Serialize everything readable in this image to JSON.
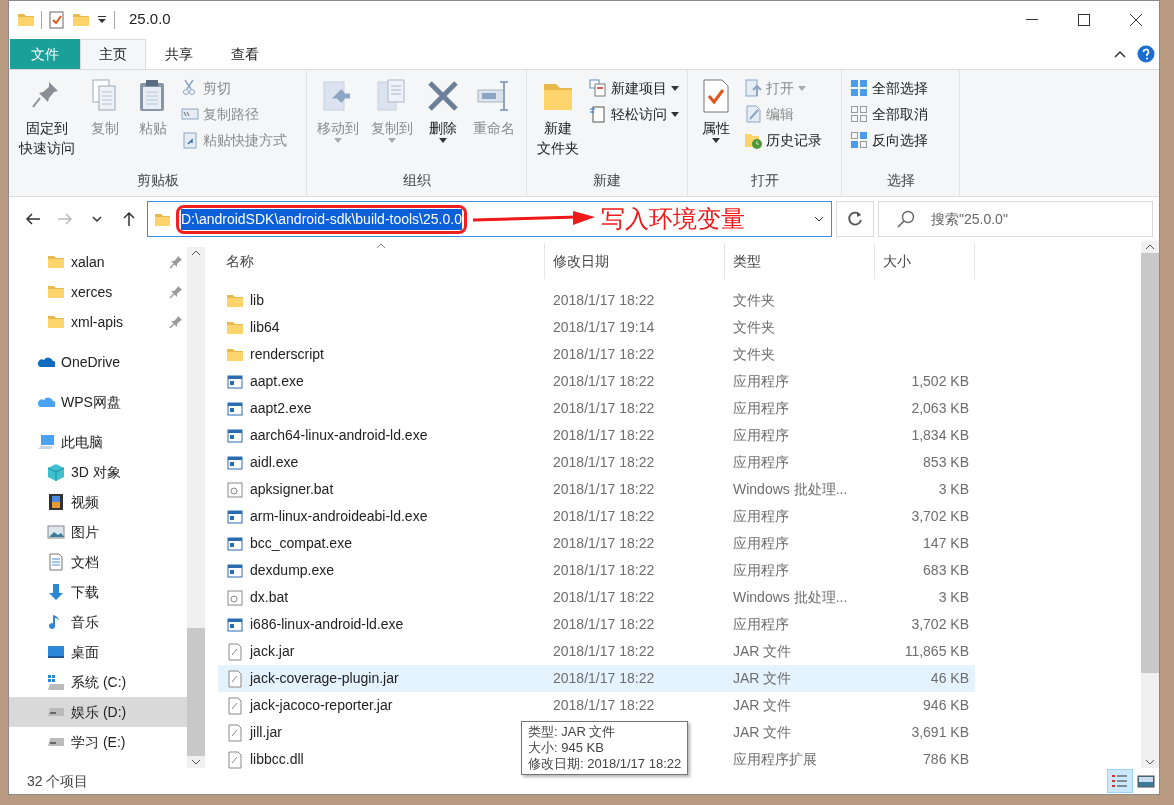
{
  "window": {
    "title": "25.0.0"
  },
  "ribbon_tabs": [
    {
      "label": "文件",
      "kind": "file",
      "selected": false
    },
    {
      "label": "主页",
      "kind": "tab",
      "selected": true
    },
    {
      "label": "共享",
      "kind": "tab",
      "selected": false
    },
    {
      "label": "查看",
      "kind": "tab",
      "selected": false
    }
  ],
  "ribbon_groups": [
    {
      "label": "剪贴板",
      "items": [
        {
          "kind": "large",
          "lines": [
            "固定到",
            "快速访问"
          ],
          "disabled": false
        },
        {
          "kind": "large",
          "lines": [
            "复制"
          ],
          "disabled": true
        },
        {
          "kind": "large",
          "lines": [
            "粘贴"
          ],
          "disabled": true
        },
        {
          "kind": "stack",
          "entries": [
            {
              "label": "剪切",
              "disabled": true
            },
            {
              "label": "复制路径",
              "disabled": true
            },
            {
              "label": "粘贴快捷方式",
              "disabled": true
            }
          ]
        }
      ]
    },
    {
      "label": "组织",
      "items": [
        {
          "kind": "large",
          "lines": [
            "移动到"
          ],
          "disabled": true,
          "dropdown": true
        },
        {
          "kind": "large",
          "lines": [
            "复制到"
          ],
          "disabled": true,
          "dropdown": true
        },
        {
          "kind": "large",
          "lines": [
            "删除"
          ],
          "disabled": false,
          "dropdown": true
        },
        {
          "kind": "large",
          "lines": [
            "重命名"
          ],
          "disabled": true
        }
      ]
    },
    {
      "label": "新建",
      "items": [
        {
          "kind": "large",
          "lines": [
            "新建",
            "文件夹"
          ],
          "disabled": false
        },
        {
          "kind": "stack",
          "entries": [
            {
              "label": "新建项目",
              "disabled": false,
              "dropdown": true
            },
            {
              "label": "轻松访问",
              "disabled": false,
              "dropdown": true
            }
          ]
        }
      ]
    },
    {
      "label": "打开",
      "items": [
        {
          "kind": "large",
          "lines": [
            "属性"
          ],
          "disabled": false,
          "dropdown": true
        },
        {
          "kind": "stack",
          "entries": [
            {
              "label": "打开",
              "disabled": true,
              "dropdown": true
            },
            {
              "label": "编辑",
              "disabled": true
            },
            {
              "label": "历史记录",
              "disabled": false
            }
          ]
        }
      ]
    },
    {
      "label": "选择",
      "items": [
        {
          "kind": "stack",
          "entries": [
            {
              "label": "全部选择",
              "disabled": false
            },
            {
              "label": "全部取消",
              "disabled": false
            },
            {
              "label": "反向选择",
              "disabled": false
            }
          ]
        }
      ]
    }
  ],
  "address": {
    "path": "D:\\androidSDK\\android-sdk\\build-tools\\25.0.0",
    "selected": true,
    "annotation": "写入环境变量"
  },
  "search": {
    "placeholder": "搜索\"25.0.0\""
  },
  "nav": [
    {
      "label": "xalan",
      "kind": "folder",
      "pinned": true,
      "selected": false
    },
    {
      "label": "xerces",
      "kind": "folder",
      "pinned": true,
      "selected": false
    },
    {
      "label": "xml-apis",
      "kind": "folder",
      "pinned": true,
      "selected": false
    },
    {
      "label": "OneDrive",
      "kind": "onedrive",
      "selected": false
    },
    {
      "label": "WPS网盘",
      "kind": "cloud",
      "selected": false
    },
    {
      "label": "此电脑",
      "kind": "pc",
      "selected": false,
      "children": [
        {
          "label": "3D 对象",
          "kind": "cube",
          "selected": false
        },
        {
          "label": "视频",
          "kind": "video",
          "selected": false
        },
        {
          "label": "图片",
          "kind": "image",
          "selected": false
        },
        {
          "label": "文档",
          "kind": "doc",
          "selected": false
        },
        {
          "label": "下载",
          "kind": "download",
          "selected": false
        },
        {
          "label": "音乐",
          "kind": "music",
          "selected": false
        },
        {
          "label": "桌面",
          "kind": "desktop",
          "selected": false
        },
        {
          "label": "系统 (C:)",
          "kind": "sysdrive",
          "selected": false
        },
        {
          "label": "娱乐 (D:)",
          "kind": "drive",
          "selected": true
        },
        {
          "label": "学习 (E:)",
          "kind": "drive",
          "selected": false
        }
      ]
    }
  ],
  "columns": [
    {
      "label": "名称",
      "sorted": true
    },
    {
      "label": "修改日期",
      "sorted": false
    },
    {
      "label": "类型",
      "sorted": false
    },
    {
      "label": "大小",
      "sorted": false
    }
  ],
  "files": [
    {
      "name": "lib",
      "kind": "folder",
      "date": "2018/1/17 18:22",
      "type": "文件夹",
      "hovered": false
    },
    {
      "name": "lib64",
      "kind": "folder",
      "date": "2018/1/17 19:14",
      "type": "文件夹",
      "hovered": false
    },
    {
      "name": "renderscript",
      "kind": "folder",
      "date": "2018/1/17 18:22",
      "type": "文件夹",
      "hovered": false
    },
    {
      "name": "aapt.exe",
      "kind": "exe",
      "date": "2018/1/17 18:22",
      "type": "应用程序",
      "size": "1,502 KB",
      "hovered": false
    },
    {
      "name": "aapt2.exe",
      "kind": "exe",
      "date": "2018/1/17 18:22",
      "type": "应用程序",
      "size": "2,063 KB",
      "hovered": false
    },
    {
      "name": "aarch64-linux-android-ld.exe",
      "kind": "exe",
      "date": "2018/1/17 18:22",
      "type": "应用程序",
      "size": "1,834 KB",
      "hovered": false
    },
    {
      "name": "aidl.exe",
      "kind": "exe",
      "date": "2018/1/17 18:22",
      "type": "应用程序",
      "size": "853 KB",
      "hovered": false
    },
    {
      "name": "apksigner.bat",
      "kind": "bat",
      "date": "2018/1/17 18:22",
      "type": "Windows 批处理...",
      "size": "3 KB",
      "hovered": false
    },
    {
      "name": "arm-linux-androideabi-ld.exe",
      "kind": "exe",
      "date": "2018/1/17 18:22",
      "type": "应用程序",
      "size": "3,702 KB",
      "hovered": false
    },
    {
      "name": "bcc_compat.exe",
      "kind": "exe",
      "date": "2018/1/17 18:22",
      "type": "应用程序",
      "size": "147 KB",
      "hovered": false
    },
    {
      "name": "dexdump.exe",
      "kind": "exe",
      "date": "2018/1/17 18:22",
      "type": "应用程序",
      "size": "683 KB",
      "hovered": false
    },
    {
      "name": "dx.bat",
      "kind": "bat",
      "date": "2018/1/17 18:22",
      "type": "Windows 批处理...",
      "size": "3 KB",
      "hovered": false
    },
    {
      "name": "i686-linux-android-ld.exe",
      "kind": "exe",
      "date": "2018/1/17 18:22",
      "type": "应用程序",
      "size": "3,702 KB",
      "hovered": false
    },
    {
      "name": "jack.jar",
      "kind": "file",
      "date": "2018/1/17 18:22",
      "type": "JAR 文件",
      "size": "11,865 KB",
      "hovered": false
    },
    {
      "name": "jack-coverage-plugin.jar",
      "kind": "file",
      "date": "2018/1/17 18:22",
      "type": "JAR 文件",
      "size": "46 KB",
      "hovered": true
    },
    {
      "name": "jack-jacoco-reporter.jar",
      "kind": "file",
      "date": "2018/1/17 18:22",
      "type": "JAR 文件",
      "size": "946 KB",
      "hovered": false
    },
    {
      "name": "jill.jar",
      "kind": "file",
      "type": "JAR 文件",
      "size": "3,691 KB",
      "hovered": false
    },
    {
      "name": "libbcc.dll",
      "kind": "file",
      "type": "应用程序扩展",
      "size": "786 KB",
      "hovered": false
    }
  ],
  "tooltip": [
    "类型: JAR 文件",
    "大小: 945 KB",
    "修改日期: 2018/1/17 18:22"
  ],
  "status_bar": {
    "count": "32 个项目"
  },
  "view_buttons": [
    {
      "kind": "details",
      "selected": true
    },
    {
      "kind": "large-icons",
      "selected": false
    }
  ]
}
